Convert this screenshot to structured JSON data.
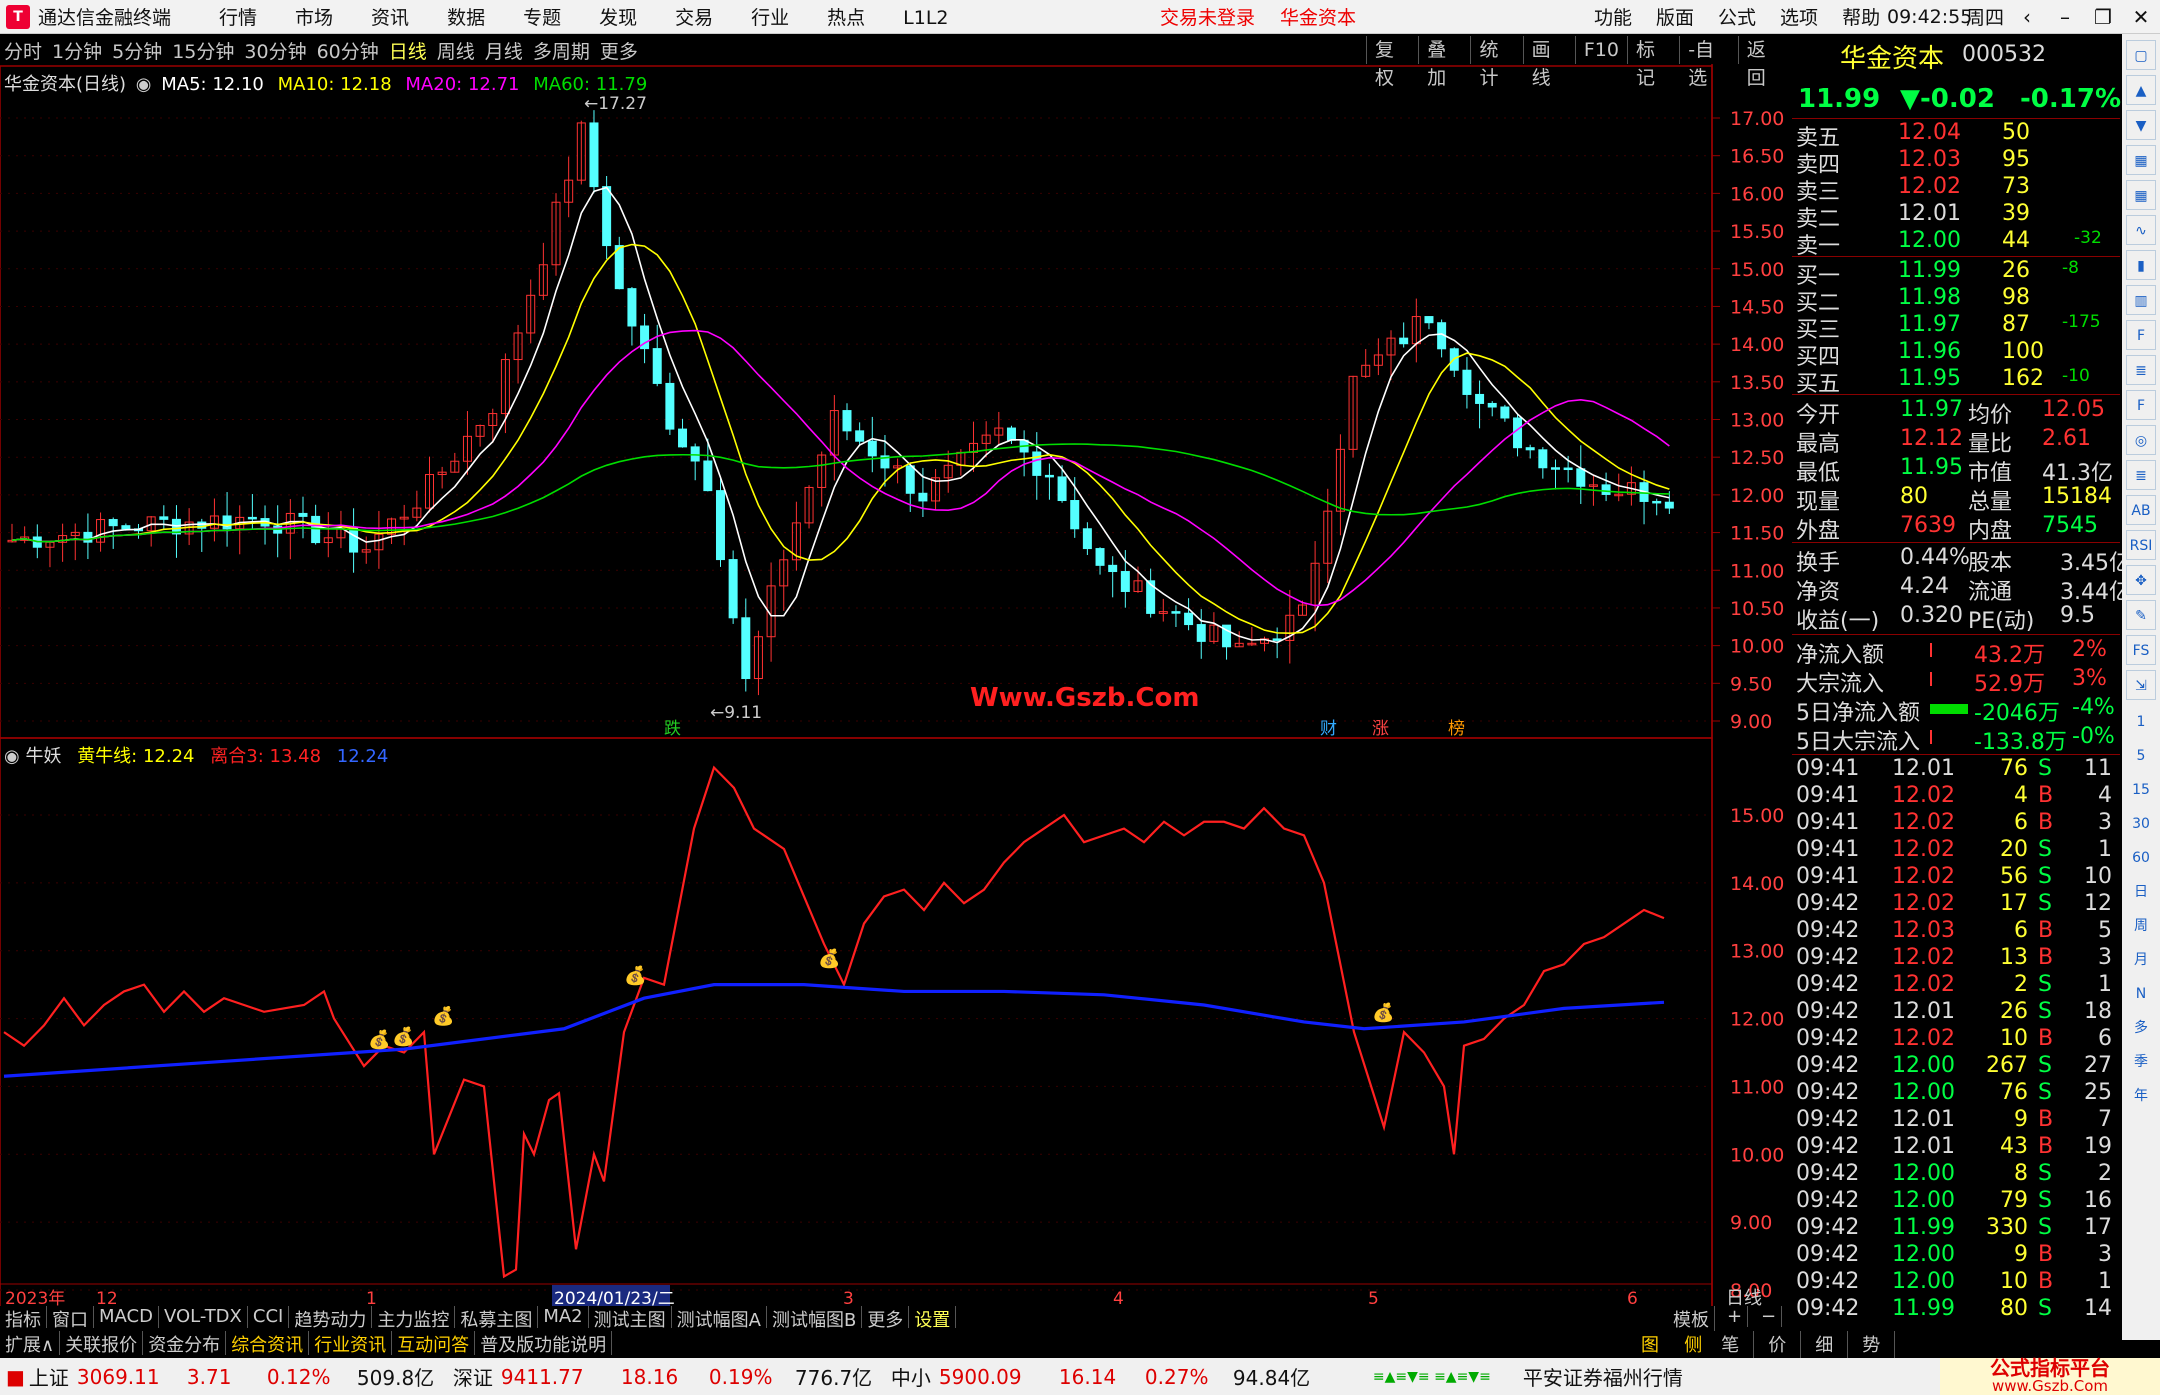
{
  "titlebar": {
    "app": "通达信金融终端",
    "menu": [
      "行情",
      "市场",
      "资讯",
      "数据",
      "专题",
      "发现",
      "交易",
      "行业",
      "热点",
      "L1L2"
    ],
    "trade_status": "交易未登录",
    "broker": "华金资本",
    "right_menu": [
      "功能",
      "版面",
      "公式",
      "选项",
      "帮助"
    ],
    "time": "09:42:55",
    "weekday": "周四"
  },
  "toolbar": {
    "periods": [
      "分时",
      "1分钟",
      "5分钟",
      "15分钟",
      "30分钟",
      "60分钟",
      "日线",
      "周线",
      "月线",
      "多周期",
      "更多"
    ],
    "active": "日线",
    "tools": [
      "复权",
      "叠加",
      "统计",
      "画线",
      "F10",
      "标记",
      "-自选",
      "返回"
    ]
  },
  "main_chart": {
    "legend_title": "华金资本(日线)",
    "ma5": "MA5: 12.10",
    "ma10": "MA10: 12.18",
    "ma20": "MA20: 12.71",
    "ma60": "MA60: 11.79",
    "high_label": "17.27",
    "low_label": "9.11",
    "watermark": "Www.Gszb.Com",
    "y_ticks": [
      "17.00",
      "16.50",
      "16.00",
      "15.50",
      "15.00",
      "14.50",
      "14.00",
      "13.50",
      "13.00",
      "12.50",
      "12.00",
      "11.50",
      "11.00",
      "10.50",
      "10.00",
      "9.50",
      "9.00"
    ],
    "event_tags": [
      "跌",
      "财",
      "涨",
      "榜"
    ]
  },
  "sub_chart": {
    "indicator": "牛妖",
    "line1": "黄牛线: 12.24",
    "line2": "离合3: 13.48",
    "line3": "12.24",
    "y_ticks": [
      "15.00",
      "14.00",
      "13.00",
      "12.00",
      "11.00",
      "10.00",
      "9.00",
      "8.00"
    ]
  },
  "time_axis": {
    "labels": [
      "2023年",
      "12",
      "1",
      "2024/01/23/二",
      "3",
      "4",
      "5",
      "6"
    ],
    "period_label": "日线"
  },
  "colors": {
    "up": "#ff3232",
    "down": "#54ffff",
    "ma5": "#ffffff",
    "ma10": "#ffff00",
    "ma20": "#ff00ff",
    "ma60": "#00dd00",
    "blue_line": "#1020ff",
    "panel_border": "#9a0000"
  },
  "quote": {
    "name": "华金资本",
    "code": "000532",
    "price": "11.99",
    "change": "▼-0.02",
    "pct": "-0.17%",
    "asks": [
      {
        "label": "卖五",
        "price": "12.04",
        "vol": "50",
        "chg": ""
      },
      {
        "label": "卖四",
        "price": "12.03",
        "vol": "95",
        "chg": ""
      },
      {
        "label": "卖三",
        "price": "12.02",
        "vol": "73",
        "chg": ""
      },
      {
        "label": "卖二",
        "price": "12.01",
        "vol": "39",
        "chg": ""
      },
      {
        "label": "卖一",
        "price": "12.00",
        "vol": "44",
        "chg": "-32"
      }
    ],
    "bids": [
      {
        "label": "买一",
        "price": "11.99",
        "vol": "26",
        "chg": "-8"
      },
      {
        "label": "买二",
        "price": "11.98",
        "vol": "98",
        "chg": ""
      },
      {
        "label": "买三",
        "price": "11.97",
        "vol": "87",
        "chg": "-175"
      },
      {
        "label": "买四",
        "price": "11.96",
        "vol": "100",
        "chg": ""
      },
      {
        "label": "买五",
        "price": "11.95",
        "vol": "162",
        "chg": "-10"
      }
    ],
    "stats": [
      [
        "今开",
        "11.97",
        "均价",
        "12.05"
      ],
      [
        "最高",
        "12.12",
        "量比",
        "2.61"
      ],
      [
        "最低",
        "11.95",
        "市值",
        "41.3亿"
      ],
      [
        "现量",
        "80",
        "总量",
        "15184"
      ],
      [
        "外盘",
        "7639",
        "内盘",
        "7545"
      ]
    ],
    "stats2": [
      [
        "换手",
        "0.44%",
        "股本",
        "3.45亿"
      ],
      [
        "净资",
        "4.24",
        "流通",
        "3.44亿"
      ],
      [
        "收益(一)",
        "0.320",
        "PE(动)",
        "9.5"
      ]
    ],
    "flows": [
      [
        "净流入额",
        "43.2万",
        "2%"
      ],
      [
        "大宗流入",
        "52.9万",
        "3%"
      ],
      [
        "5日净流入额",
        "-2046万",
        "-4%"
      ],
      [
        "5日大宗流入",
        "-133.8万",
        "-0%"
      ]
    ]
  },
  "ticks": [
    [
      "09:41",
      "12.01",
      "76",
      "S",
      "11"
    ],
    [
      "09:41",
      "12.02",
      "4",
      "B",
      "4"
    ],
    [
      "09:41",
      "12.02",
      "6",
      "B",
      "3"
    ],
    [
      "09:41",
      "12.02",
      "20",
      "S",
      "1"
    ],
    [
      "09:41",
      "12.02",
      "56",
      "S",
      "10"
    ],
    [
      "09:42",
      "12.02",
      "17",
      "S",
      "12"
    ],
    [
      "09:42",
      "12.03",
      "6",
      "B",
      "5"
    ],
    [
      "09:42",
      "12.02",
      "13",
      "B",
      "3"
    ],
    [
      "09:42",
      "12.02",
      "2",
      "S",
      "1"
    ],
    [
      "09:42",
      "12.01",
      "26",
      "S",
      "18"
    ],
    [
      "09:42",
      "12.02",
      "10",
      "B",
      "6"
    ],
    [
      "09:42",
      "12.00",
      "267",
      "S",
      "27"
    ],
    [
      "09:42",
      "12.00",
      "76",
      "S",
      "25"
    ],
    [
      "09:42",
      "12.01",
      "9",
      "B",
      "7"
    ],
    [
      "09:42",
      "12.01",
      "43",
      "B",
      "19"
    ],
    [
      "09:42",
      "12.00",
      "8",
      "S",
      "2"
    ],
    [
      "09:42",
      "12.00",
      "79",
      "S",
      "16"
    ],
    [
      "09:42",
      "11.99",
      "330",
      "S",
      "17"
    ],
    [
      "09:42",
      "12.00",
      "9",
      "B",
      "3"
    ],
    [
      "09:42",
      "12.00",
      "10",
      "B",
      "1"
    ],
    [
      "09:42",
      "11.99",
      "80",
      "S",
      "14"
    ]
  ],
  "sidebar": {
    "labels": [
      "1",
      "5",
      "15",
      "30",
      "60",
      "日",
      "周",
      "月",
      "N",
      "多",
      "季",
      "年"
    ]
  },
  "tabs1": [
    "指标",
    "窗口",
    "MACD",
    "VOL-TDX",
    "CCI",
    "趋势动力",
    "主力监控",
    "私募主图",
    "MA2",
    "测试主图",
    "测试幅图A",
    "测试幅图B",
    "更多",
    "设置"
  ],
  "tabs1_right": "模板",
  "tabs2": [
    "扩展∧",
    "关联报价",
    "资金分布",
    "综合资讯",
    "行业资讯",
    "互动问答",
    "普及版功能说明"
  ],
  "tabs2_right": [
    "图文F10",
    "侧边栏《",
    "笔",
    "价",
    "细",
    "势"
  ],
  "status": {
    "sh_label": "上证",
    "sh_val": "3069.11",
    "sh_chg": "3.71",
    "sh_pct": "0.12%",
    "sh_amt": "509.8亿",
    "sz_label": "深证",
    "sz_val": "9411.77",
    "sz_chg": "18.16",
    "sz_pct": "0.19%",
    "sz_amt": "776.7亿",
    "zx_label": "中小",
    "zx_val": "5900.09",
    "zx_chg": "16.14",
    "zx_pct": "0.27%",
    "zx_amt": "94.84亿",
    "feed": "平安证券福州行情",
    "brand": "公式指标平台",
    "brand_url": "www.Gszb.Com"
  }
}
